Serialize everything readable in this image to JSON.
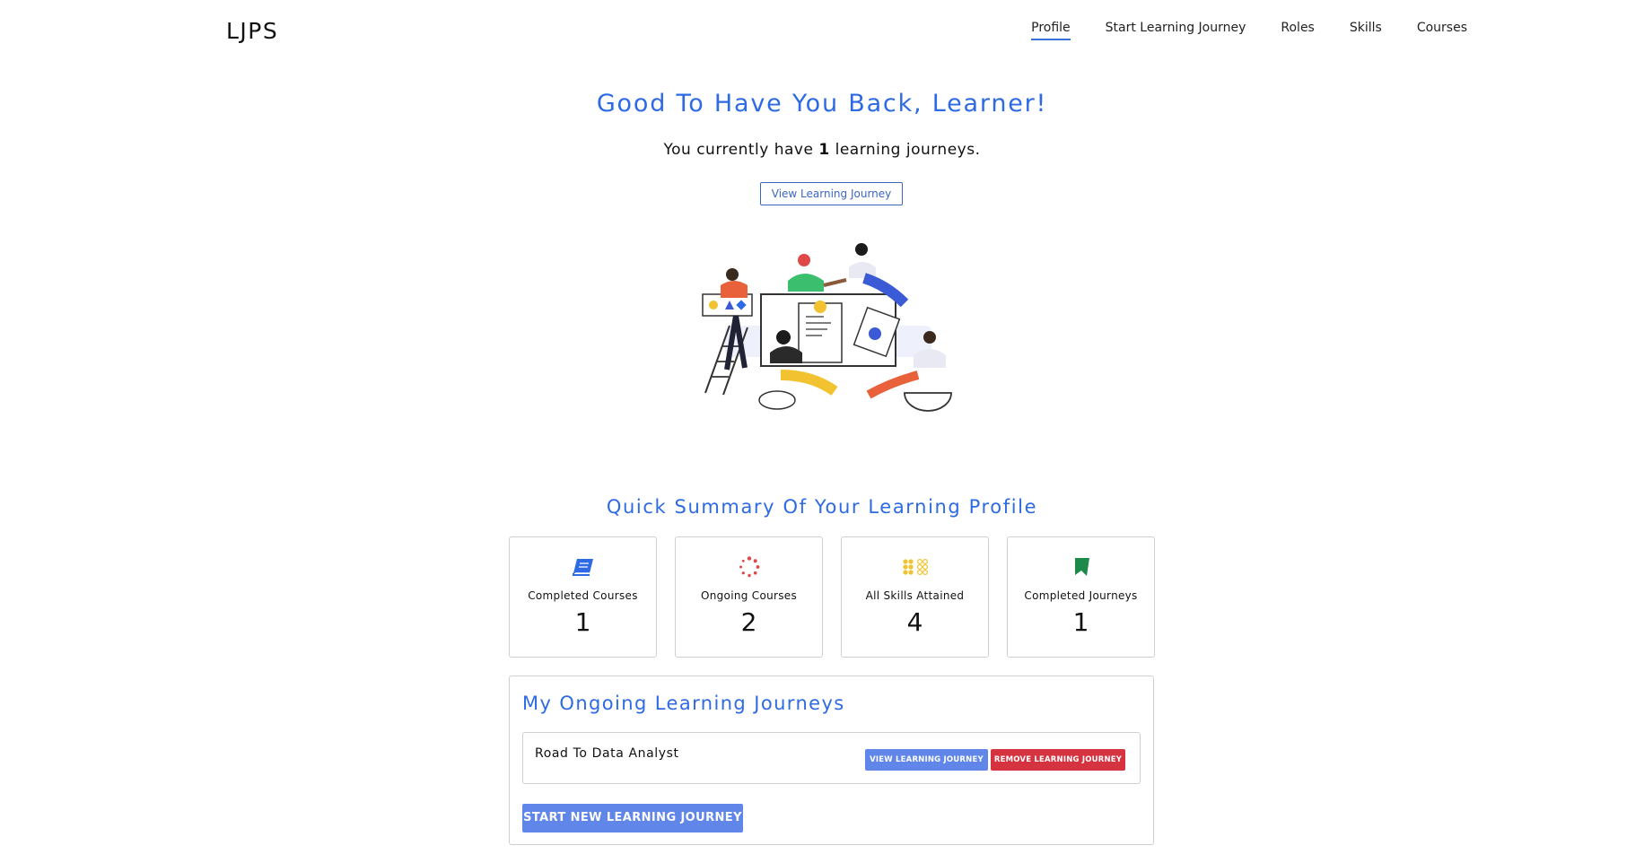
{
  "brand": "LJPS",
  "nav": {
    "items": [
      {
        "label": "Profile",
        "active": true
      },
      {
        "label": "Start Learning Journey",
        "active": false
      },
      {
        "label": "Roles",
        "active": false
      },
      {
        "label": "Skills",
        "active": false
      },
      {
        "label": "Courses",
        "active": false
      }
    ]
  },
  "hero": {
    "title": "Good To Have You Back, Learner!",
    "subtitle_prefix": "You currently have ",
    "journey_count": "1",
    "subtitle_suffix": " learning journeys.",
    "view_button": "View Learning Journey"
  },
  "summary": {
    "title": "Quick Summary Of Your Learning Profile",
    "cards": [
      {
        "label": "Completed Courses",
        "value": "1",
        "icon": "book-icon",
        "color": "#2d6ae3"
      },
      {
        "label": "Ongoing Courses",
        "value": "2",
        "icon": "spinner-icon",
        "color": "#e04848"
      },
      {
        "label": "All Skills Attained",
        "value": "4",
        "icon": "grid-icon",
        "color": "#f2c230"
      },
      {
        "label": "Completed Journeys",
        "value": "1",
        "icon": "bookmark-icon",
        "color": "#1e8a4a"
      }
    ]
  },
  "journeys": {
    "title": "My Ongoing Learning Journeys",
    "items": [
      {
        "name": "Road To Data Analyst",
        "view_label": "VIEW LEARNING JOURNEY",
        "remove_label": "REMOVE LEARNING JOURNEY"
      }
    ],
    "start_button": "START NEW LEARNING JOURNEY"
  },
  "colors": {
    "accent": "#2d6ae3",
    "button_blue": "#5f86e8",
    "button_red": "#d63340"
  }
}
